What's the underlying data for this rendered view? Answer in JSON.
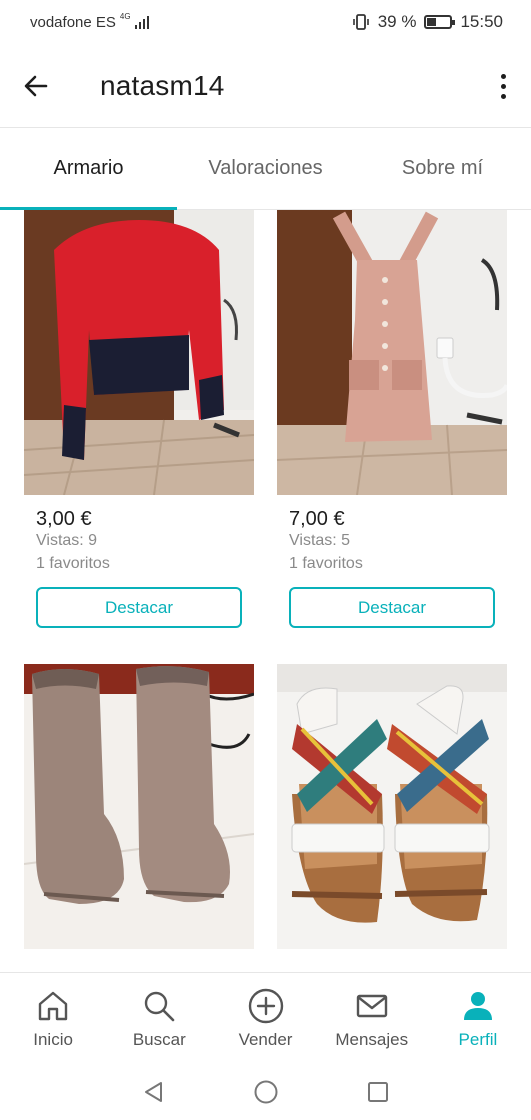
{
  "status_bar": {
    "carrier": "vodafone ES",
    "network": "4G",
    "battery_text": "39 %",
    "battery_level": 0.39,
    "time": "15:50"
  },
  "header": {
    "back_icon": "arrow-left-icon",
    "title": "natasm14",
    "more_icon": "more-vertical-icon"
  },
  "tabs": [
    {
      "label": "Armario",
      "active": true
    },
    {
      "label": "Valoraciones",
      "active": false
    },
    {
      "label": "Sobre mí",
      "active": false
    }
  ],
  "colors": {
    "accent": "#09b1ba",
    "text_primary": "#1d1d1d",
    "text_secondary": "#8a8a8a"
  },
  "items": [
    {
      "image": "red-black-sweater",
      "price": "3,00 €",
      "views": "Vistas: 9",
      "favorites": "1 favoritos",
      "button": "Destacar"
    },
    {
      "image": "pink-corduroy-dungaree-dress",
      "price": "7,00 €",
      "views": "Vistas: 5",
      "favorites": "1 favoritos",
      "button": "Destacar"
    },
    {
      "image": "taupe-suede-boots"
    },
    {
      "image": "colorful-strap-sandals"
    }
  ],
  "bottom_nav": [
    {
      "label": "Inicio",
      "icon": "home-icon",
      "active": false
    },
    {
      "label": "Buscar",
      "icon": "search-icon",
      "active": false
    },
    {
      "label": "Vender",
      "icon": "plus-circle-icon",
      "active": false
    },
    {
      "label": "Mensajes",
      "icon": "mail-icon",
      "active": false
    },
    {
      "label": "Perfil",
      "icon": "profile-icon",
      "active": true
    }
  ],
  "system_nav": [
    "back-triangle-icon",
    "home-circle-icon",
    "recents-square-icon"
  ]
}
